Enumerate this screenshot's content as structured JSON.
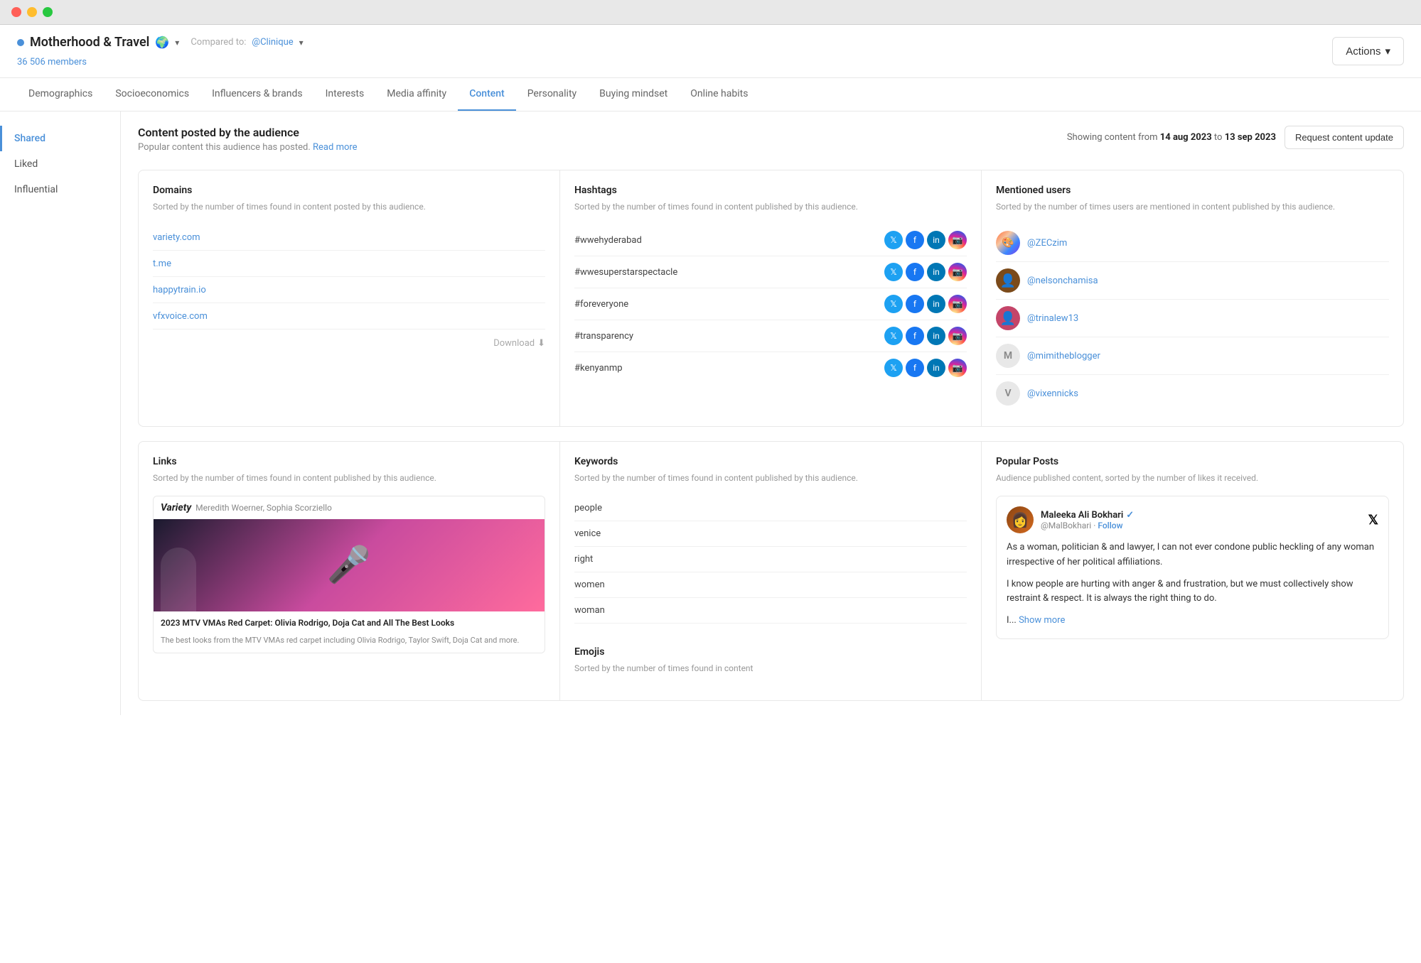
{
  "browser": {
    "traffic_lights": [
      "red",
      "yellow",
      "green"
    ]
  },
  "header": {
    "audience_dot_color": "#4a90d9",
    "title": "Motherhood & Travel",
    "globe": "🌍",
    "dropdown_label": "▾",
    "compared_to_label": "Compared to:",
    "compared_to_handle": "@Clinique",
    "members_count": "36 506 members",
    "actions_label": "Actions",
    "actions_arrow": "▾"
  },
  "nav": {
    "tabs": [
      {
        "label": "Demographics",
        "active": false
      },
      {
        "label": "Socioeconomics",
        "active": false
      },
      {
        "label": "Influencers & brands",
        "active": false
      },
      {
        "label": "Interests",
        "active": false
      },
      {
        "label": "Media affinity",
        "active": false
      },
      {
        "label": "Content",
        "active": true
      },
      {
        "label": "Personality",
        "active": false
      },
      {
        "label": "Buying mindset",
        "active": false
      },
      {
        "label": "Online habits",
        "active": false
      }
    ]
  },
  "sidebar": {
    "items": [
      {
        "label": "Shared",
        "active": true
      },
      {
        "label": "Liked",
        "active": false
      },
      {
        "label": "Influential",
        "active": false
      }
    ]
  },
  "content": {
    "section_title": "Content posted by the audience",
    "section_desc": "Popular content this audience has posted.",
    "read_more": "Read more",
    "date_label": "Showing content from",
    "date_from": "14 aug 2023",
    "date_to_label": "to",
    "date_to": "13 sep 2023",
    "request_btn": "Request content update",
    "domains": {
      "title": "Domains",
      "desc": "Sorted by the number of times found in content posted by this audience.",
      "items": [
        {
          "url": "variety.com"
        },
        {
          "url": "t.me"
        },
        {
          "url": "happytrain.io"
        },
        {
          "url": "vfxvoice.com"
        }
      ],
      "download_label": "Download"
    },
    "hashtags": {
      "title": "Hashtags",
      "desc": "Sorted by the number of times found in content published by this audience.",
      "items": [
        {
          "tag": "#wwehyderabad"
        },
        {
          "tag": "#wwesuperstarspectacle"
        },
        {
          "tag": "#foreveryone"
        },
        {
          "tag": "#transparency"
        },
        {
          "tag": "#kenyanmp"
        }
      ]
    },
    "mentioned_users": {
      "title": "Mentioned users",
      "desc": "Sorted by the number of times users are mentioned in content published by this audience.",
      "items": [
        {
          "handle": "@ZECzim",
          "avatar_type": "zec"
        },
        {
          "handle": "@nelsonchamisa",
          "avatar_type": "nelson"
        },
        {
          "handle": "@trinalew13",
          "avatar_type": "trina"
        },
        {
          "handle": "@mimitheblogger",
          "avatar_type": "mimi",
          "letter": "M"
        },
        {
          "handle": "@vixennicks",
          "avatar_type": "vixen",
          "letter": "V"
        }
      ]
    },
    "links": {
      "title": "Links",
      "desc": "Sorted by the number of times found in content published by this audience.",
      "card": {
        "source": "Variety",
        "authors": "Meredith Woerner, Sophia Scorziello",
        "title": "2023 MTV VMAs Red Carpet: Olivia Rodrigo, Doja Cat and All The Best Looks",
        "desc": "The best looks from the MTV VMAs red carpet including Olivia Rodrigo, Taylor Swift, Doja Cat and more."
      }
    },
    "keywords": {
      "title": "Keywords",
      "desc": "Sorted by the number of times found in content published by this audience.",
      "items": [
        "people",
        "venice",
        "right",
        "women",
        "woman"
      ]
    },
    "popular_posts": {
      "title": "Popular Posts",
      "desc": "Audience published content, sorted by the number of likes it received.",
      "post": {
        "username": "Maleeka Ali Bokhari",
        "verified": true,
        "handle": "@MalBokhari",
        "follow_label": "Follow",
        "separator": "·",
        "text_1": "As a woman, politician & and lawyer, I can not ever condone public heckling of any woman irrespective of her political affiliations.",
        "text_2": "I know people are hurting with anger & and frustration, but we must collectively show restraint & respect. It is always the right thing to do.",
        "text_3": "I...",
        "show_more": "Show more"
      }
    },
    "emojis": {
      "title": "Emojis",
      "desc": "Sorted by the number of times found in content"
    }
  }
}
